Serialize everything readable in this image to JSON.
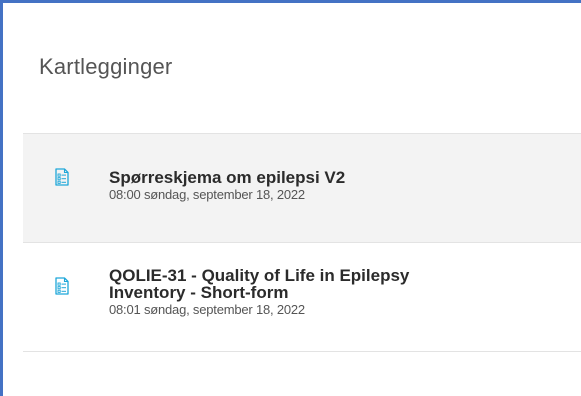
{
  "panel": {
    "title": "Kartlegginger"
  },
  "accent_color": "#4472c4",
  "icon_color": "#1ea7d9",
  "items": [
    {
      "icon": "document-checklist-icon",
      "title": "Spørreskjema om epilepsi V2",
      "date": "08:00 søndag, september 18, 2022",
      "selected": true
    },
    {
      "icon": "document-checklist-icon",
      "title_line1": "QOLIE-31 - Quality of Life in Epilepsy",
      "title_line2": "Inventory - Short-form",
      "date": "08:01 søndag, september 18, 2022",
      "selected": false
    }
  ]
}
